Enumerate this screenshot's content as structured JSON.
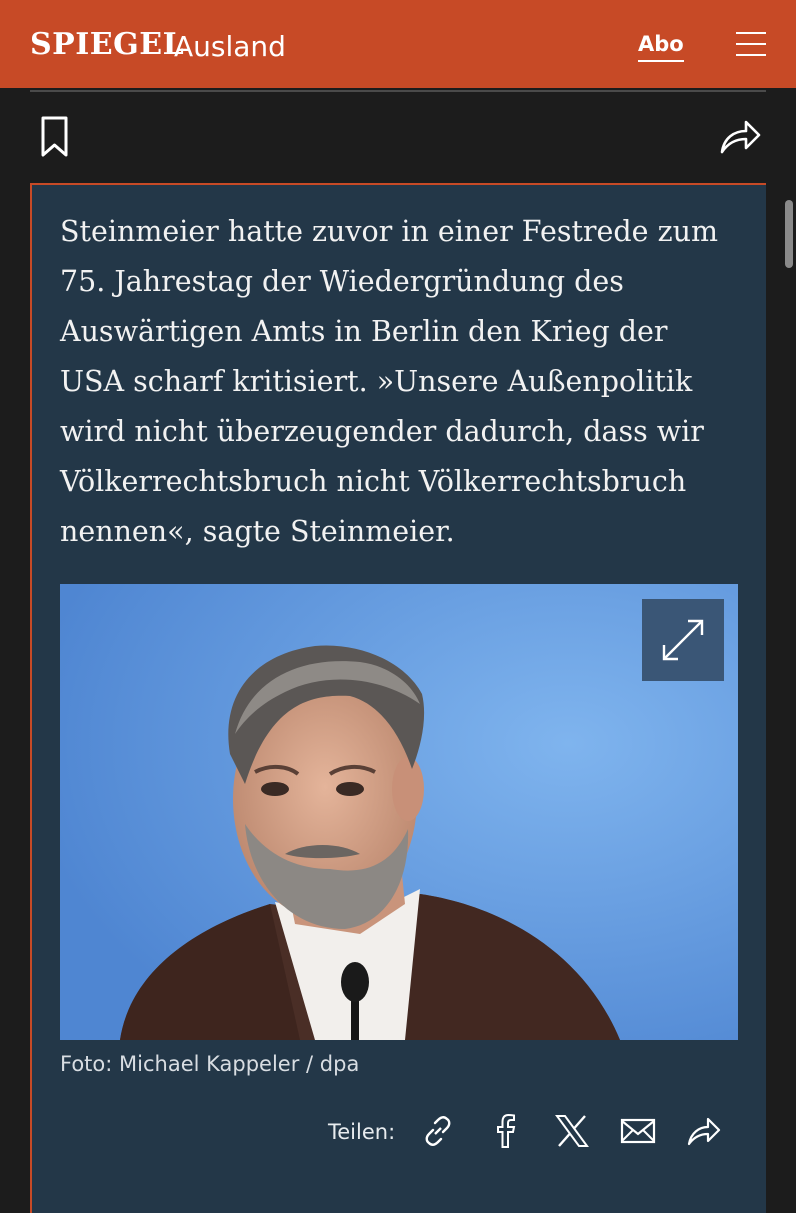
{
  "header": {
    "logo": "SPIEGEL",
    "section": "Ausland",
    "abo_label": "Abo",
    "brand_color": "#c74a26"
  },
  "toolbar": {
    "bookmark_icon": "bookmark-icon",
    "share_icon": "share-arrow-icon"
  },
  "article": {
    "paragraph": "Steinmeier hatte zuvor in einer Festrede zum 75. Jahrestag der Wiedergründung des Auswärtigen Amts in Berlin den Krieg der USA scharf kritisiert. »Unsere Außenpolitik wird nicht überzeugender dadurch, dass wir Völkerrechtsbruch nicht Völkerrechtsbruch nennen«, sagte Steinmeier.",
    "photo_caption": "Foto: Michael Kappeler / dpa",
    "expand_icon": "expand-icon"
  },
  "share": {
    "label": "Teilen:",
    "icons": [
      "link-icon",
      "facebook-icon",
      "x-icon",
      "mail-icon",
      "share-arrow-icon"
    ]
  }
}
